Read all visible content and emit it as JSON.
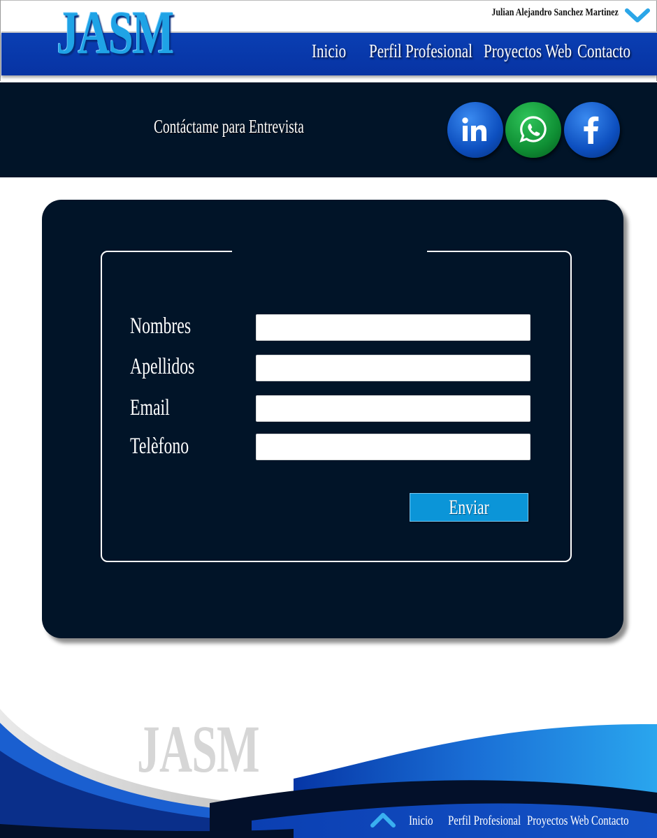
{
  "header": {
    "logo": "JASM",
    "user_name": "Julian Alejandro Sanchez Martinez",
    "nav": [
      "Inicio",
      "Perfil Profesional",
      "Proyectos Web",
      "Contacto"
    ]
  },
  "banner": {
    "title": "Contáctame para Entrevista",
    "social": [
      "linkedin-icon",
      "whatsapp-icon",
      "facebook-icon"
    ]
  },
  "form": {
    "fields": [
      {
        "label": "Nombres",
        "value": ""
      },
      {
        "label": "Apellidos",
        "value": ""
      },
      {
        "label": "Email",
        "value": ""
      },
      {
        "label": "Telèfono",
        "value": ""
      }
    ],
    "submit_label": "Enviar"
  },
  "footer": {
    "logo": "JASM",
    "nav": [
      "Inicio",
      "Perfil Profesional",
      "Proyectos Web",
      "Contacto"
    ]
  },
  "colors": {
    "nav_blue": "#0a3fb3",
    "dark_navy": "#011428",
    "accent_blue": "#0b95d8",
    "whatsapp_green": "#0f8f34"
  }
}
